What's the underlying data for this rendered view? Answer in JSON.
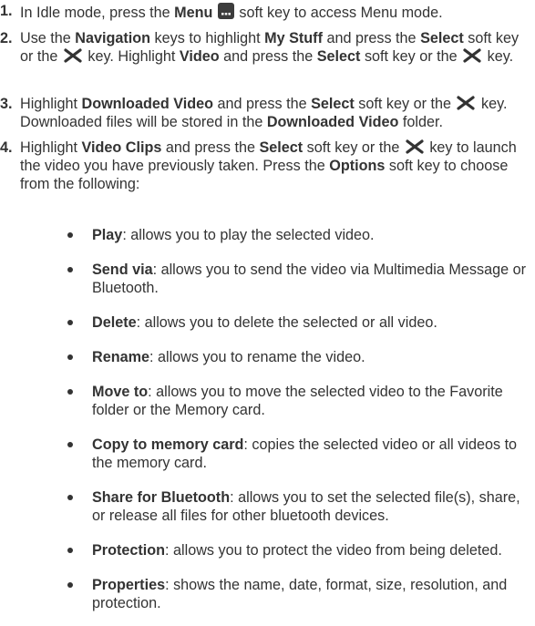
{
  "steps": [
    {
      "number": "1.",
      "parts": [
        "In Idle mode, press the ",
        "Menu",
        " soft key to access Menu mode."
      ]
    },
    {
      "number": "2.",
      "parts": [
        "Use the ",
        "Navigation",
        " keys to highlight ",
        "My Stuff",
        " and press the ",
        "Select",
        " soft key or the ",
        " key. Highlight ",
        "Video",
        " and press the ",
        "Select",
        " soft key or the ",
        " key."
      ]
    },
    {
      "number": "3.",
      "parts": [
        "Highlight ",
        "Downloaded Video",
        " and press the ",
        "Select",
        " soft key or the ",
        " key. Downloaded files will be stored in the ",
        "Downloaded Video",
        " folder."
      ]
    },
    {
      "number": "4.",
      "parts": [
        "Highlight ",
        "Video Clips",
        " and press the ",
        "Select",
        " soft key or the ",
        " key to launch the video you have previously taken. Press the ",
        "Options",
        " soft key to choose from the following:"
      ]
    }
  ],
  "options": [
    {
      "term": "Play",
      "desc": ": allows you to play the selected video."
    },
    {
      "term": "Send via",
      "desc": ": allows you to send the video via Multimedia Message or Bluetooth."
    },
    {
      "term": "Delete",
      "desc": ": allows you to delete the selected or all video."
    },
    {
      "term": "Rename",
      "desc": ": allows you to rename the video."
    },
    {
      "term": "Move to",
      "desc": ": allows you to move the selected video to the Favorite folder or the Memory card."
    },
    {
      "term": "Copy to memory card",
      "desc": ": copies the selected video or all videos to the memory card."
    },
    {
      "term": "Share for Bluetooth",
      "desc": ": allows you to set the selected file(s), share, or release all files for other bluetooth devices."
    },
    {
      "term": "Protection",
      "desc": ": allows you to protect the video from being deleted."
    },
    {
      "term": "Properties",
      "desc": ": shows the name, date, format, size, resolution,  and protection."
    }
  ],
  "icons": {
    "menu_key": "menu-key-icon",
    "select_key": "select-key-icon"
  }
}
